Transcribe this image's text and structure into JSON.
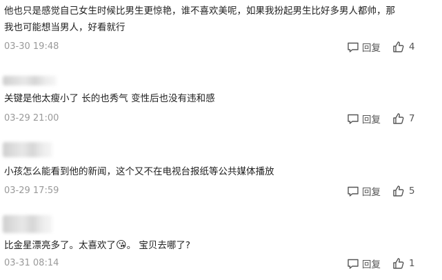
{
  "comments": [
    {
      "lines": [
        "他也只是感觉自己女生时候比男生更惊艳，谁不喜欢美呢，如果我扮起男生比好多男人都帅，那",
        "我也可能想当男人，好看就行"
      ],
      "time": "03-30 19:48",
      "reply_label": "回复",
      "likes": "4"
    },
    {
      "lines": [
        "关键是他太瘦小了 长的也秀气 变性后也没有违和感"
      ],
      "time": "03-29 21:00",
      "reply_label": "回复",
      "likes": "7"
    },
    {
      "lines": [
        "小孩怎么能看到他的新闻，这个又不在电视台报纸等公共媒体播放"
      ],
      "time": "03-29 17:59",
      "reply_label": "回复",
      "likes": "5"
    },
    {
      "text_before": "比金星漂亮多了。太喜欢了",
      "emoji": "😘",
      "text_after": "。 宝贝去哪了?",
      "time": "03-31 08:14",
      "reply_label": "回复",
      "likes": "1"
    }
  ],
  "icons": {
    "reply": "comment-bubble-icon",
    "like": "thumbs-up-icon"
  }
}
